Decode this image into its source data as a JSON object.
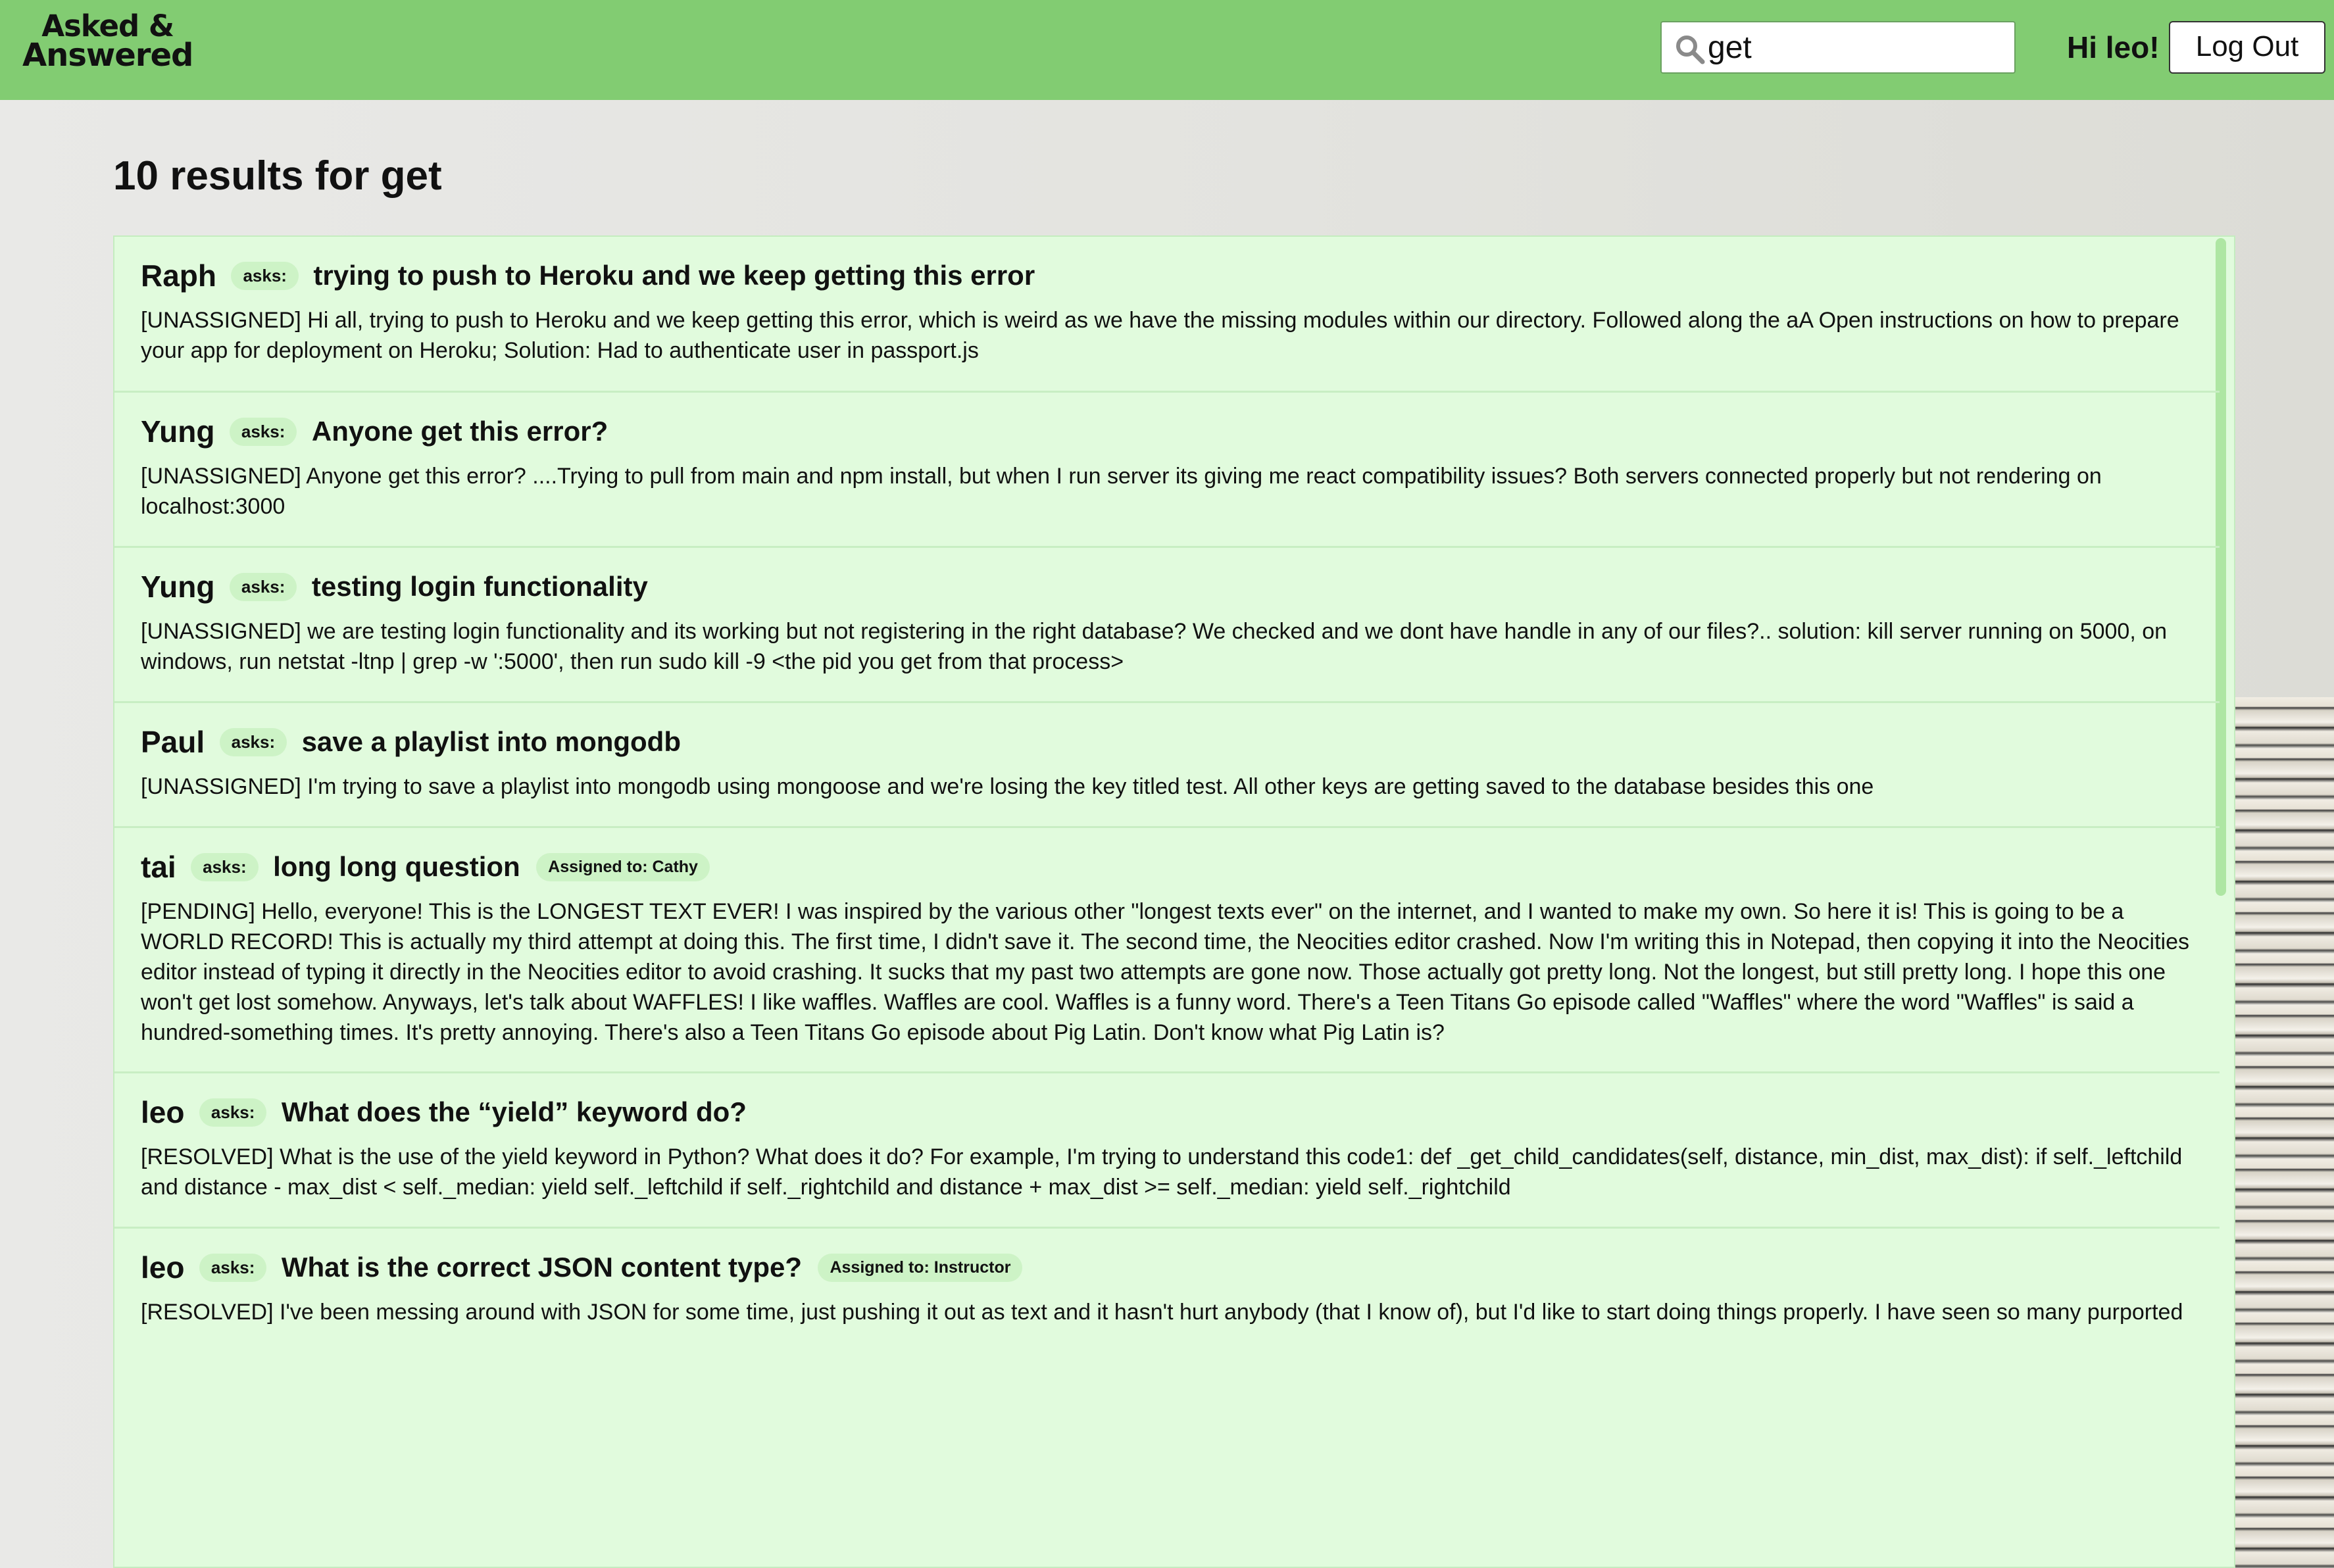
{
  "header": {
    "logo_line1": "Asked &",
    "logo_line2": "Answered",
    "search_value": "get",
    "greeting": "Hi leo!",
    "logout_label": "Log Out"
  },
  "results_title": "10 results for get",
  "asks_label": "asks:",
  "questions": [
    {
      "author": "Raph",
      "title": "trying to push to Heroku and we keep getting this error",
      "assigned": "",
      "body": "[UNASSIGNED] Hi all, trying to push to Heroku and we keep getting this error, which is weird as we have the missing modules within our directory. Followed along the aA Open instructions on how to prepare your app for deployment on Heroku; Solution: Had to authenticate user in passport.js"
    },
    {
      "author": "Yung",
      "title": "Anyone get this error?",
      "assigned": "",
      "body": "[UNASSIGNED] Anyone get this error? ....Trying to pull from main and npm install, but when I run server its giving me react compatibility issues? Both servers connected properly but not rendering on localhost:3000"
    },
    {
      "author": "Yung",
      "title": "testing login functionality",
      "assigned": "",
      "body": "[UNASSIGNED] we are testing login functionality and its working but not registering in the right database? We checked and we dont have handle in any of our files?.. solution: kill server running on 5000, on windows, run netstat -ltnp | grep -w ':5000', then run sudo kill -9 <the pid you get from that process>"
    },
    {
      "author": "Paul",
      "title": "save a playlist into mongodb",
      "assigned": "",
      "body": "[UNASSIGNED] I'm trying to save a playlist into mongodb using mongoose and we're losing the key titled test. All other keys are getting saved to the database besides this one"
    },
    {
      "author": "tai",
      "title": "long long question",
      "assigned": "Assigned to: Cathy",
      "body": "[PENDING] Hello, everyone! This is the LONGEST TEXT EVER! I was inspired by the various other \"longest texts ever\" on the internet, and I wanted to make my own. So here it is! This is going to be a WORLD RECORD! This is actually my third attempt at doing this. The first time, I didn't save it. The second time, the Neocities editor crashed. Now I'm writing this in Notepad, then copying it into the Neocities editor instead of typing it directly in the Neocities editor to avoid crashing. It sucks that my past two attempts are gone now. Those actually got pretty long. Not the longest, but still pretty long. I hope this one won't get lost somehow. Anyways, let's talk about WAFFLES! I like waffles. Waffles are cool. Waffles is a funny word. There's a Teen Titans Go episode called \"Waffles\" where the word \"Waffles\" is said a hundred-something times. It's pretty annoying. There's also a Teen Titans Go episode about Pig Latin. Don't know what Pig Latin is?"
    },
    {
      "author": "leo",
      "title": "What does the “yield” keyword do?",
      "assigned": "",
      "body": "[RESOLVED] What is the use of the yield keyword in Python? What does it do? For example, I'm trying to understand this code1: def _get_child_candidates(self, distance, min_dist, max_dist): if self._leftchild and distance - max_dist < self._median: yield self._leftchild if self._rightchild and distance + max_dist >= self._median: yield self._rightchild"
    },
    {
      "author": "leo",
      "title": "What is the correct JSON content type?",
      "assigned": "Assigned to: Instructor",
      "body": "[RESOLVED] I've been messing around with JSON for some time, just pushing it out as text and it hasn't hurt anybody (that I know of), but I'd like to start doing things properly. I have seen so many purported"
    }
  ]
}
